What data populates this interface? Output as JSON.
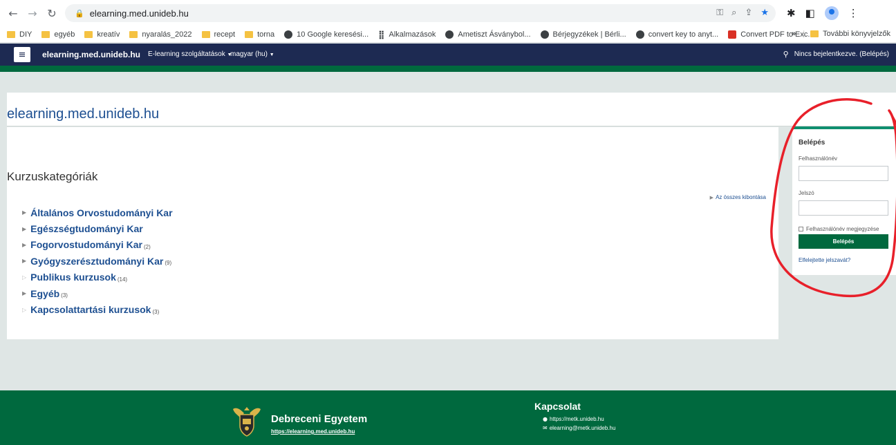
{
  "browser": {
    "url": "elearning.med.unideb.hu",
    "bookmarks": [
      {
        "label": "DIY",
        "icon": "folder-icon"
      },
      {
        "label": "egyéb",
        "icon": "folder-icon"
      },
      {
        "label": "kreatív",
        "icon": "folder-icon"
      },
      {
        "label": "nyaralás_2022",
        "icon": "folder-icon"
      },
      {
        "label": "recept",
        "icon": "folder-icon"
      },
      {
        "label": "torna",
        "icon": "folder-icon"
      },
      {
        "label": "10 Google keresési...",
        "icon": "globe-icon"
      },
      {
        "label": "Alkalmazások",
        "icon": "apps-grid-icon"
      },
      {
        "label": "Ametiszt Ásványbol...",
        "icon": "globe-icon"
      },
      {
        "label": "Bérjegyzékek | Bérli...",
        "icon": "globe-icon"
      },
      {
        "label": "convert key to anyt...",
        "icon": "globe-icon"
      },
      {
        "label": "Convert PDF to Exc...",
        "icon": "pdf-icon"
      }
    ],
    "more_bookmarks": "»",
    "other_bookmarks": "További könyvjelzők"
  },
  "navbar": {
    "menu_icon": "≡",
    "brand": "elearning.med.unideb.hu",
    "menu_items": [
      "E-learning szolgáltatások",
      "magyar (hu)"
    ],
    "login_status": "Nincs bejelentkezve. (Belépés)"
  },
  "header": {
    "site_title": "elearning.med.unideb.hu"
  },
  "main": {
    "heading": "Kurzuskategóriák",
    "expand_all": "Az összes kibontása",
    "categories": [
      {
        "name": "Általános Orvostudományi Kar",
        "count": ""
      },
      {
        "name": "Egészségtudományi Kar",
        "count": ""
      },
      {
        "name": "Fogorvostudományi Kar",
        "count": "(2)"
      },
      {
        "name": "Gyógyszerésztudományi Kar",
        "count": "(9)"
      },
      {
        "name": "Publikus kurzusok",
        "count": "(14)"
      },
      {
        "name": "Egyéb",
        "count": "(3)"
      },
      {
        "name": "Kapcsolattartási kurzusok",
        "count": "(3)"
      }
    ]
  },
  "login": {
    "title": "Belépés",
    "username_label": "Felhasználónév",
    "password_label": "Jelszó",
    "remember_label": "Felhasználónév megjegyzése",
    "button": "Belépés",
    "forgot": "Elfelejtette jelszavát?"
  },
  "footer": {
    "university": "Debreceni Egyetem",
    "link": "https://elearning.med.unideb.hu",
    "contact_heading": "Kapcsolat",
    "website": "https://metk.unideb.hu",
    "email": "elearning@metk.unideb.hu"
  },
  "colors": {
    "navbar": "#1d2a52",
    "accent": "#00693e",
    "link": "#1d4f91",
    "annotation": "#e8202a"
  }
}
